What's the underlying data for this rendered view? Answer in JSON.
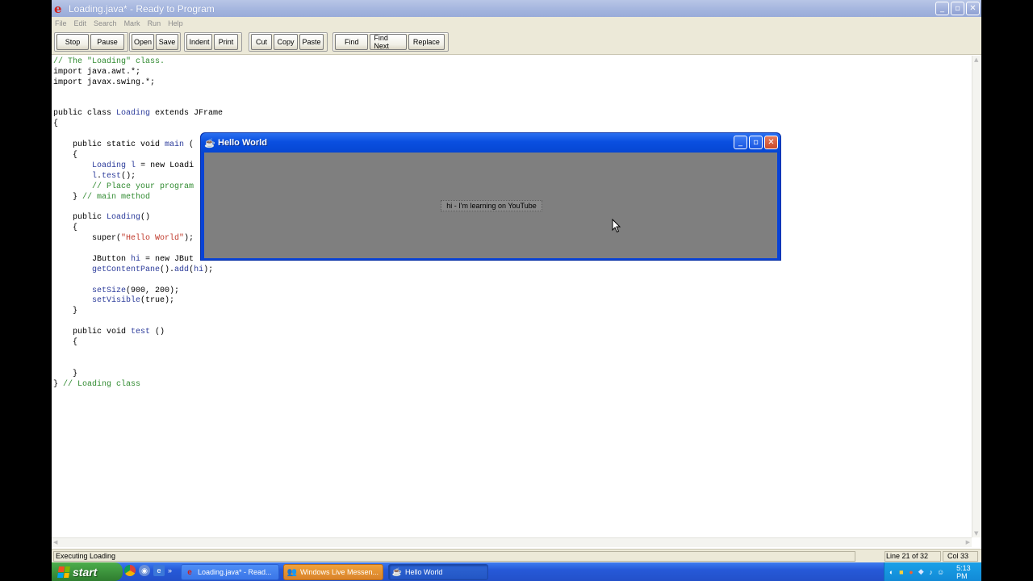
{
  "window": {
    "title": "Loading.java* - Ready to Program",
    "app_icon_glyph": "e",
    "minimize_glyph": "_",
    "maximize_glyph": "▫",
    "close_glyph": "✕"
  },
  "menu": [
    "File",
    "Edit",
    "Search",
    "Mark",
    "Run",
    "Help"
  ],
  "toolbar": {
    "group1": [
      "Stop",
      "Pause"
    ],
    "group2": [
      "Open",
      "Save"
    ],
    "group3": [
      "Indent",
      "Print"
    ],
    "group4": [
      "Cut",
      "Copy",
      "Paste"
    ],
    "group5": [
      "Find",
      "Find Next",
      "Replace"
    ]
  },
  "code_lines": [
    "// The \"Loading\" class.",
    "import java.awt.*;",
    "import javax.swing.*;",
    "",
    "",
    "public class Loading extends JFrame",
    "{",
    "",
    "    public static void main (",
    "    {",
    "        Loading l = new Loadi",
    "        l.test();",
    "        // Place your program",
    "    } // main method",
    "",
    "    public Loading()",
    "    {",
    "        super(\"Hello World\");",
    "",
    "        JButton hi = new JBut",
    "        getContentPane().add(hi);",
    "",
    "        setSize(900, 200);",
    "        setVisible(true);",
    "    }",
    "",
    "    public void test ()",
    "    {",
    "",
    "",
    "    }",
    "} // Loading class"
  ],
  "status": {
    "message": "Executing Loading",
    "line": "Line 21 of 32",
    "col": "Col 33"
  },
  "taskbar": {
    "start_label": "start",
    "quick_launch_more": "»",
    "tasks": [
      {
        "label": "Loading.java* - Read...",
        "icon": "e"
      },
      {
        "label": "Windows Live Messen...",
        "icon": "👥"
      },
      {
        "label": "Hello World",
        "icon": "☕"
      }
    ],
    "clock": "5:13 PM"
  },
  "java_window": {
    "title": "Hello World",
    "button_label": "hi - I'm learning on YouTube"
  },
  "colors": {
    "title_gradient": "#a3b4de",
    "comment_green": "#2f8a2f",
    "identifier_blue": "#2a3a9a",
    "string_red": "#c0392b",
    "xp_blue": "#0a4fe0",
    "content_gray": "#7f7f7f"
  }
}
